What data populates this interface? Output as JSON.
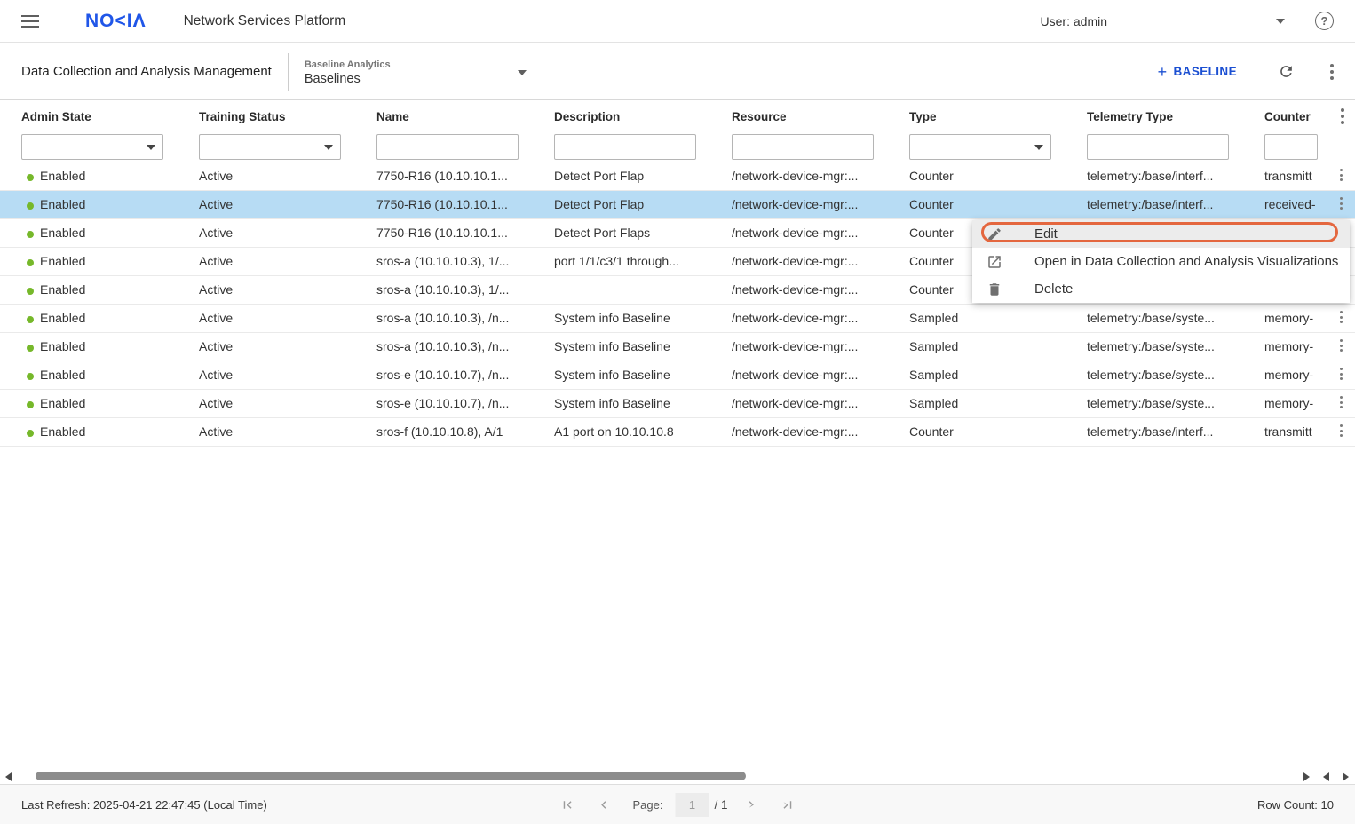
{
  "header": {
    "brand": "NOKIA",
    "brand_display": "NO<IΛ",
    "app_title": "Network Services Platform",
    "user_menu": "User: admin"
  },
  "action_bar": {
    "page_title": "Data Collection and Analysis Management",
    "selector_label": "Baseline Analytics",
    "selector_value": "Baselines",
    "add_button_plus": "+",
    "add_button_label": "BASELINE"
  },
  "table": {
    "columns": [
      {
        "label": "Admin State",
        "filter": "select"
      },
      {
        "label": "Training Status",
        "filter": "select"
      },
      {
        "label": "Name",
        "filter": "text"
      },
      {
        "label": "Description",
        "filter": "text"
      },
      {
        "label": "Resource",
        "filter": "text"
      },
      {
        "label": "Type",
        "filter": "select"
      },
      {
        "label": "Telemetry Type",
        "filter": "text"
      },
      {
        "label": "Counter",
        "filter": "text"
      }
    ],
    "rows": [
      {
        "admin_state": "Enabled",
        "training_status": "Active",
        "name": "7750-R16 (10.10.10.1...",
        "description": "Detect Port Flap",
        "resource": "/network-device-mgr:...",
        "type": "Counter",
        "telemetry_type": "telemetry:/base/interf...",
        "counter": "transmitt",
        "selected": false
      },
      {
        "admin_state": "Enabled",
        "training_status": "Active",
        "name": "7750-R16 (10.10.10.1...",
        "description": "Detect Port Flap",
        "resource": "/network-device-mgr:...",
        "type": "Counter",
        "telemetry_type": "telemetry:/base/interf...",
        "counter": "received-",
        "selected": true
      },
      {
        "admin_state": "Enabled",
        "training_status": "Active",
        "name": "7750-R16 (10.10.10.1...",
        "description": "Detect Port Flaps",
        "resource": "/network-device-mgr:...",
        "type": "Counter",
        "telemetry_type": "",
        "counter": "",
        "selected": false
      },
      {
        "admin_state": "Enabled",
        "training_status": "Active",
        "name": "sros-a (10.10.10.3), 1/...",
        "description": "port 1/1/c3/1 through...",
        "resource": "/network-device-mgr:...",
        "type": "Counter",
        "telemetry_type": "",
        "counter": "",
        "selected": false
      },
      {
        "admin_state": "Enabled",
        "training_status": "Active",
        "name": "sros-a (10.10.10.3), 1/...",
        "description": "",
        "resource": "/network-device-mgr:...",
        "type": "Counter",
        "telemetry_type": "",
        "counter": "",
        "selected": false
      },
      {
        "admin_state": "Enabled",
        "training_status": "Active",
        "name": "sros-a (10.10.10.3), /n...",
        "description": "System info Baseline",
        "resource": "/network-device-mgr:...",
        "type": "Sampled",
        "telemetry_type": "telemetry:/base/syste...",
        "counter": "memory-",
        "selected": false
      },
      {
        "admin_state": "Enabled",
        "training_status": "Active",
        "name": "sros-a (10.10.10.3), /n...",
        "description": "System info Baseline",
        "resource": "/network-device-mgr:...",
        "type": "Sampled",
        "telemetry_type": "telemetry:/base/syste...",
        "counter": "memory-",
        "selected": false
      },
      {
        "admin_state": "Enabled",
        "training_status": "Active",
        "name": "sros-e (10.10.10.7), /n...",
        "description": "System info Baseline",
        "resource": "/network-device-mgr:...",
        "type": "Sampled",
        "telemetry_type": "telemetry:/base/syste...",
        "counter": "memory-",
        "selected": false
      },
      {
        "admin_state": "Enabled",
        "training_status": "Active",
        "name": "sros-e (10.10.10.7), /n...",
        "description": "System info Baseline",
        "resource": "/network-device-mgr:...",
        "type": "Sampled",
        "telemetry_type": "telemetry:/base/syste...",
        "counter": "memory-",
        "selected": false
      },
      {
        "admin_state": "Enabled",
        "training_status": "Active",
        "name": "sros-f (10.10.10.8), A/1",
        "description": "A1 port on 10.10.10.8",
        "resource": "/network-device-mgr:...",
        "type": "Counter",
        "telemetry_type": "telemetry:/base/interf...",
        "counter": "transmitt",
        "selected": false
      }
    ]
  },
  "context_menu": {
    "items": [
      {
        "label": "Edit",
        "icon": "pencil-icon",
        "highlighted": true
      },
      {
        "label": "Open in Data Collection and Analysis Visualizations",
        "icon": "open-in-new-icon",
        "highlighted": false
      },
      {
        "label": "Delete",
        "icon": "trash-icon",
        "highlighted": false
      }
    ]
  },
  "footer": {
    "last_refresh": "Last Refresh: 2025-04-21 22:47:45 (Local Time)",
    "page_label": "Page:",
    "page_value": "1",
    "page_total": "/ 1",
    "row_count": "Row Count: 10"
  },
  "colors": {
    "accent_blue": "#1b4fd2",
    "logo_blue": "#2056e8",
    "selected_row": "#b7dcf4",
    "status_green": "#76b82a",
    "highlight_ring": "#e4673f"
  }
}
